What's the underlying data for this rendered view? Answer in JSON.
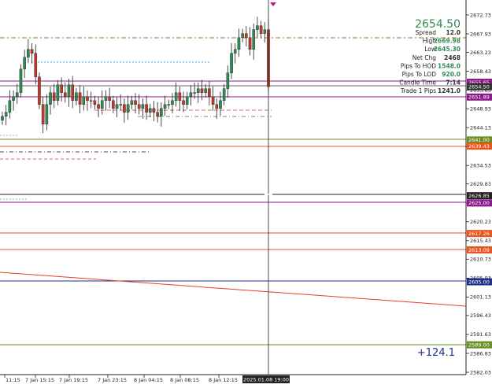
{
  "chart_data": {
    "type": "candlestick",
    "price_axis": {
      "ticks": [
        "2672.73",
        "2667.93",
        "2663.23",
        "2658.43",
        "2653.63",
        "2648.93",
        "2644.13",
        "2639.33",
        "2634.53",
        "2629.83",
        "2625.03",
        "2620.23",
        "2615.43",
        "2610.73",
        "2605.93",
        "2601.13",
        "2596.43",
        "2591.63",
        "2586.83",
        "2582.03"
      ],
      "range": [
        2582.03,
        2674.5
      ]
    },
    "time_axis": {
      "ticks": [
        "11:15",
        "7 Jan 15:15",
        "7 Jan 19:15",
        "7 Jan 23:15",
        "8 Jan 04:15",
        "8 Jan 08:15",
        "8 Jan 12:15"
      ],
      "cursor_time": "2025.01.08 19:00"
    },
    "price_level_labels": [
      {
        "text": "2655.65",
        "price": 2655.65,
        "color": "#8b1a8b"
      },
      {
        "text": "2654.50",
        "price": 2654.5,
        "color": "#333333"
      },
      {
        "text": "2651.89",
        "price": 2651.89,
        "color": "#8b1a8b"
      },
      {
        "text": "2641.00",
        "price": 2641.0,
        "color": "#6b8e23"
      },
      {
        "text": "2639.43",
        "price": 2639.43,
        "color": "#e8561c"
      },
      {
        "text": "2626.85",
        "price": 2626.85,
        "color": "#222222"
      },
      {
        "text": "2625.00",
        "price": 2625.0,
        "color": "#8b1a8b"
      },
      {
        "text": "2617.26",
        "price": 2617.26,
        "color": "#e8561c"
      },
      {
        "text": "2613.09",
        "price": 2613.09,
        "color": "#e8561c"
      },
      {
        "text": "2605.00",
        "price": 2605.0,
        "color": "#1f2f8b"
      },
      {
        "text": "2589.00",
        "price": 2589.0,
        "color": "#6b8e23"
      }
    ],
    "candles_close": [
      2647,
      2648,
      2651,
      2652,
      2653,
      2659,
      2662,
      2664,
      2663,
      2657,
      2650,
      2645,
      2650,
      2653,
      2651,
      2655,
      2653,
      2652,
      2655,
      2651,
      2653,
      2650,
      2652,
      2651,
      2651,
      2650,
      2649,
      2651,
      2652,
      2651,
      2649,
      2650,
      2650,
      2648,
      2650,
      2651,
      2650,
      2649,
      2650,
      2648,
      2649,
      2648,
      2647,
      2649,
      2650,
      2650,
      2651,
      2653,
      2651,
      2650,
      2652,
      2653,
      2653,
      2654,
      2653,
      2654,
      2652,
      2650,
      2649,
      2651,
      2654,
      2658,
      2663,
      2664,
      2667,
      2668,
      2667,
      2664,
      2669,
      2670,
      2668,
      2669,
      2654.5
    ],
    "info_panel": {
      "price": "2654.50",
      "rows": [
        {
          "label": "Spread",
          "value": "12.0",
          "color": "#333333"
        },
        {
          "label": "High",
          "value": "2669.98",
          "color": "#2e8b57"
        },
        {
          "label": "Low",
          "value": "2645.30",
          "color": "#2e8b57"
        },
        {
          "label": "Net Chg",
          "value": "2468",
          "color": "#333333"
        },
        {
          "label": "Pips To HOD",
          "value": "1548.0",
          "color": "#2e8b57"
        },
        {
          "label": "Pips To LOD",
          "value": "920.0",
          "color": "#2e8b57"
        },
        {
          "label": "Candle Time",
          "value": "7:14",
          "color": "#333333"
        },
        {
          "label": "Trade 1 Pips",
          "value": "1241.0",
          "color": "#333333"
        }
      ]
    },
    "bottom_value": "+124.1",
    "colors": {
      "bull": "#2e8b57",
      "bear": "#c0392b",
      "price_big": "#2e8b57",
      "bottom_value": "#1f2f8b"
    }
  }
}
